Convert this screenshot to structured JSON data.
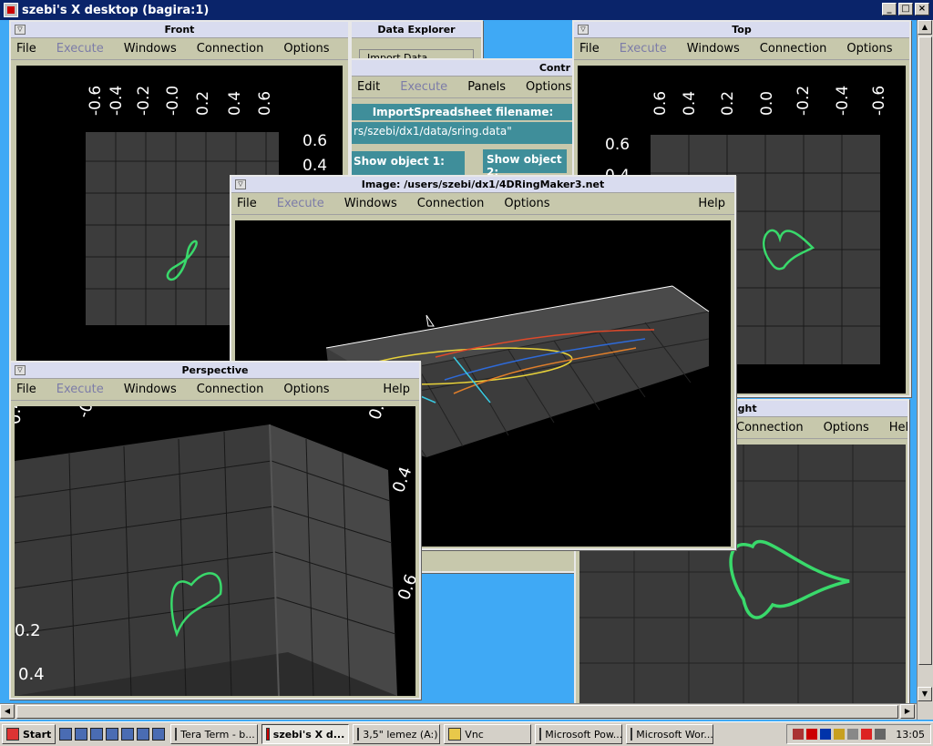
{
  "vnc": {
    "title": "szebi's X desktop (bagira:1)",
    "min": "_",
    "max": "□",
    "close": "×"
  },
  "menus": {
    "file": "File",
    "execute": "Execute",
    "windows": "Windows",
    "connection": "Connection",
    "options": "Options",
    "help": "Help",
    "edit": "Edit",
    "panels": "Panels"
  },
  "front": {
    "title": "Front",
    "xticks": [
      "-0.6",
      "-0.4",
      "-0.2",
      "-0.0",
      "0.2",
      "0.4",
      "0.6"
    ],
    "yticks": [
      "0.6",
      "0.4"
    ]
  },
  "top": {
    "title": "Top",
    "xticks": [
      "0.6",
      "0.4",
      "0.2",
      "0.0",
      "-0.2",
      "-0.4",
      "-0.6"
    ],
    "yticks": [
      "0.6",
      "0.4"
    ]
  },
  "dataexplorer": {
    "title": "Data Explorer",
    "import": "Import Data"
  },
  "control": {
    "title": "Contr",
    "import_label": "ImportSpreadsheet filename:",
    "filename": "rs/szebi/dx1/data/sring.data\"",
    "show1": "Show object 1:",
    "show2": "Show object 2:"
  },
  "image": {
    "title": "Image: /users/szebi/dx1/4DRingMaker3.net"
  },
  "right": {
    "title": "Right"
  },
  "perspective": {
    "title": "Perspective",
    "labels": [
      "0.4",
      "-0.6",
      "0.6",
      "0.4",
      "0.6",
      "0.2",
      "0.4"
    ]
  },
  "taskbar": {
    "start": "Start",
    "items": [
      "Tera Term - b...",
      "szebi's X d...",
      "3,5\" lemez (A:)",
      "Vnc",
      "Microsoft Pow...",
      "Microsoft Wor..."
    ],
    "clock": "13:05"
  }
}
